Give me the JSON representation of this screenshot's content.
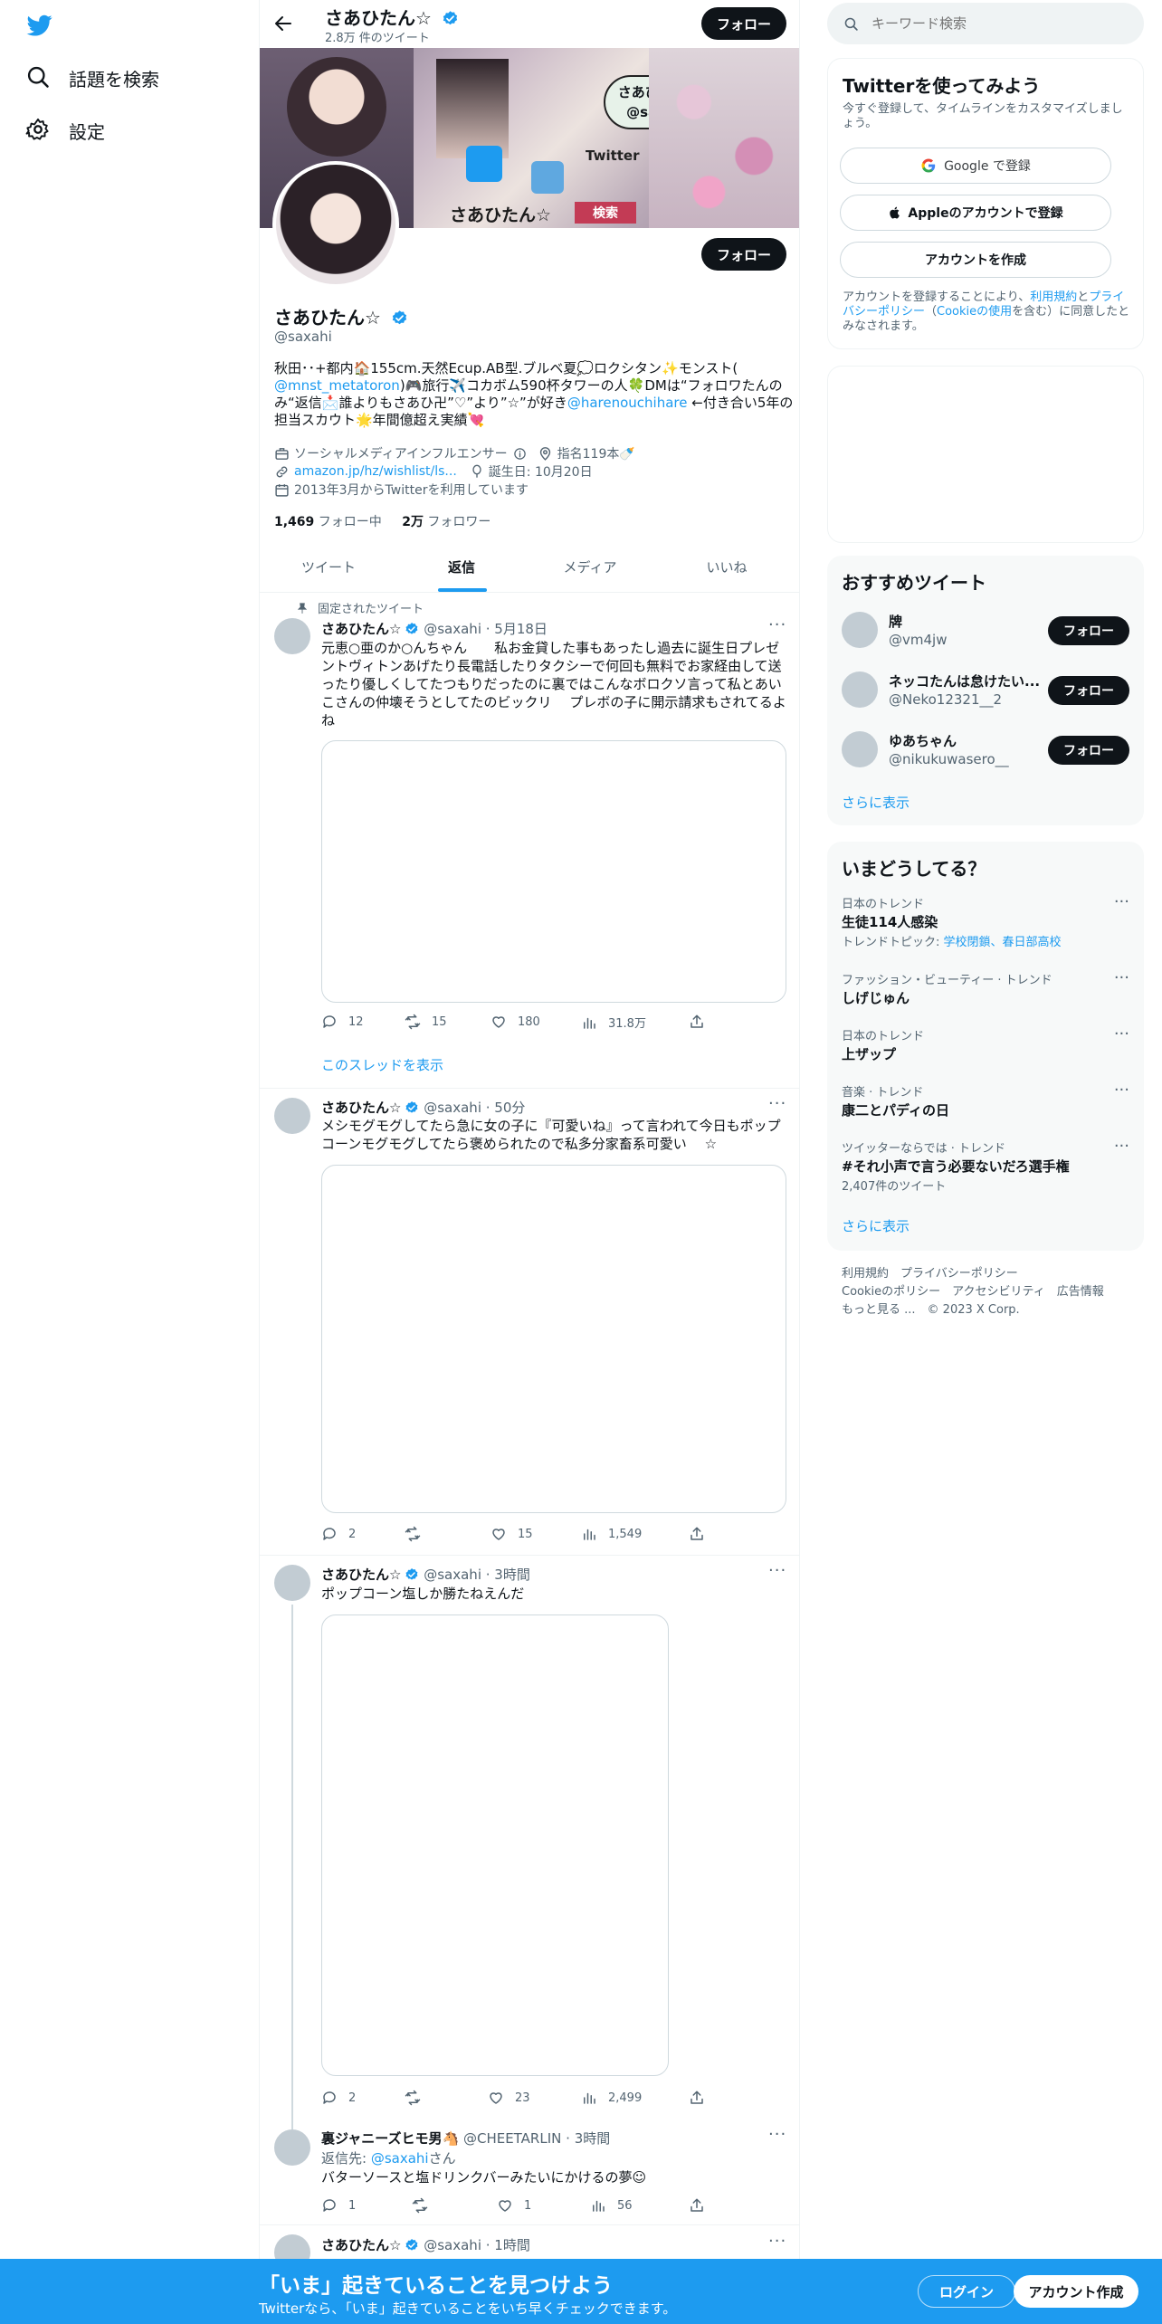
{
  "nav": {
    "explore_label": "話題を検索",
    "settings_label": "設定"
  },
  "header": {
    "name": "さあひたん☆",
    "tweet_count": "2.8万 件のツイート",
    "follow_label": "フォロー"
  },
  "banner": {
    "caption_main": "さあひたん☆",
    "caption_handle": "@saxahi",
    "caption_twitter": "Twitter",
    "caption_search": "検索",
    "caption_bottom": "さあひたん☆"
  },
  "profile": {
    "name": "さあひたん☆",
    "handle": "@saxahi",
    "follow_label": "フォロー",
    "bio_line1": "秋田･･+都内🏠155cm.天然Ecup.AB型.ブルベ夏💭ロクシタン✨モンスト(",
    "bio_line2_link": "@mnst_metatoron",
    "bio_line2_rest": ")🎮旅行✈️コカボム590杯タワーの人🍀DMは“フォロワたんの",
    "bio_line3_a": "み“返信📩誰よりもさあひ卍”♡”より”☆”が好き",
    "bio_line3_link": "@harenouchihare",
    "bio_line3_b": " ←付き合い5年の",
    "bio_line4": "担当スカウト🌟年間億超え実績💘",
    "category": "ソーシャルメディアインフルエンサー",
    "location": "指名119本🍼",
    "url": "amazon.jp/hz/wishlist/ls...",
    "birthday": "誕生日: 10月20日",
    "joined": "2013年3月からTwitterを利用しています",
    "following_count": "1,469",
    "following_label": "フォロー中",
    "followers_count": "2万",
    "followers_label": "フォロワー"
  },
  "tabs": [
    "ツイート",
    "返信",
    "メディア",
    "いいね"
  ],
  "tweets": [
    {
      "pinned_label": "固定されたツイート",
      "name": "さあひたん☆",
      "handle": "@saxahi",
      "time": "· 5月18日",
      "text": "元恵○亜のか○んちゃん　　私お金貸した事もあったし過去に誕生日プレゼントヴィトンあげたり長電話したりタクシーで何回も無料でお家経由して送ったり優しくしてたつもりだったのに裏ではこんなボロクソ言って私とあいこさんの仲壊そうとしてたのビックリ　 プレボの子に開示請求もされてるよね",
      "replies": "12",
      "retweets": "15",
      "likes": "180",
      "views": "31.8万",
      "thread_label": "このスレッドを表示"
    },
    {
      "name": "さあひたん☆",
      "handle": "@saxahi",
      "time": "· 50分",
      "text": "メシモグモグしてたら急に女の子に『可愛いね』って言われて今日もポップコーンモグモグしてたら褒められたので私多分家畜系可愛い　 ☆",
      "replies": "2",
      "retweets": "",
      "likes": "15",
      "views": "1,549"
    },
    {
      "name": "さあひたん☆",
      "handle": "@saxahi",
      "time": "· 3時間",
      "text": "ポップコーン塩しか勝たねえんだ",
      "replies": "2",
      "retweets": "",
      "likes": "23",
      "views": "2,499"
    },
    {
      "name": "裏ジャニーズヒモ男🐴",
      "handle": "@CHEETARLIN",
      "time": "· 3時間",
      "reply_to_label": "返信先: ",
      "reply_to_link": "@saxahi",
      "reply_to_suffix": "さん",
      "text": "バターソースと塩ドリンクバーみたいにかけるの夢☺",
      "replies": "1",
      "retweets": "",
      "likes": "1",
      "views": "56"
    },
    {
      "name": "さあひたん☆",
      "handle": "@saxahi",
      "time": "· 1時間"
    }
  ],
  "right": {
    "search_placeholder": "キーワード検索",
    "signup": {
      "title": "Twitterを使ってみよう",
      "subtitle": "今すぐ登録して、タイムラインをカスタマイズしましょう。",
      "google_label": "Google で登録",
      "apple_label": "Appleのアカウントで登録",
      "create_label": "アカウントを作成",
      "legal_a": "アカウントを登録することにより、",
      "legal_terms": "利用規約",
      "legal_b": "と",
      "legal_privacy": "プライバシーポリシー",
      "legal_c": "（",
      "legal_cookie": "Cookieの使用",
      "legal_d": "を含む）に同意したとみなされます。"
    },
    "recommend": {
      "title": "おすすめツイート",
      "follow_label": "フォロー",
      "users": [
        {
          "name": "牌",
          "handle": "@vm4jw"
        },
        {
          "name": "ネッコたんは怠けたい...",
          "handle": "@Neko12321__2"
        },
        {
          "name": "ゆあちゃん",
          "handle": "@nikukuwasero__"
        }
      ],
      "more": "さらに表示"
    },
    "trends": {
      "title": "いまどうしてる？",
      "items": [
        {
          "context": "日本のトレンド",
          "name": "生徒114人感染",
          "extra_prefix": "トレンドトピック: ",
          "extra_link": "学校閉鎖、春日部高校"
        },
        {
          "context": "ファッション・ビューティー · トレンド",
          "name": "しげじゅん"
        },
        {
          "context": "日本のトレンド",
          "name": "上ザップ"
        },
        {
          "context": "音楽 · トレンド",
          "name": "康二とパディの日"
        },
        {
          "context": "ツイッターならでは · トレンド",
          "name": "#それ小声で言う必要ないだろ選手権",
          "count": "2,407件のツイート"
        }
      ],
      "more": "さらに表示"
    },
    "footer": {
      "terms": "利用規約",
      "privacy": "プライバシーポリシー",
      "cookie": "Cookieのポリシー",
      "accessibility": "アクセシビリティ",
      "ads": "広告情報",
      "more": "もっと見る ...",
      "copyright": "© 2023 X Corp."
    }
  },
  "bottom": {
    "title": "「いま」起きていることを見つけよう",
    "subtitle": "Twitterなら、「いま」起きていることをいち早くチェックできます。",
    "login_label": "ログイン",
    "signup_label": "アカウント作成"
  }
}
